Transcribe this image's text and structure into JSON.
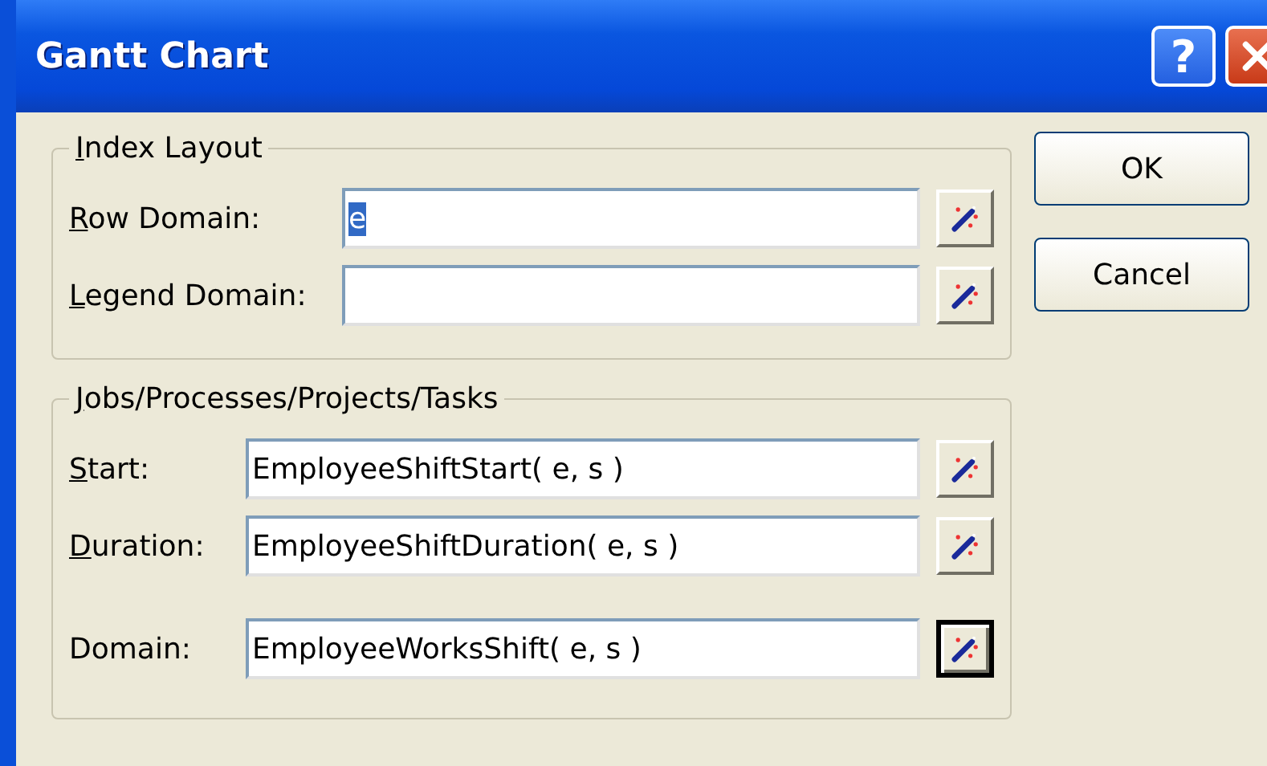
{
  "window": {
    "title": "Gantt Chart",
    "title_buttons": [
      {
        "kind": "help",
        "label": "?"
      },
      {
        "kind": "close"
      }
    ]
  },
  "groups": [
    {
      "title": "Index Layout",
      "underlined_key": true,
      "fields": [
        {
          "label": "Row Domain:",
          "underlined_key": true,
          "value": "e",
          "value_selected": true,
          "button_focused": false
        },
        {
          "label": "Legend Domain:",
          "underlined_key": true,
          "button_focused": false
        }
      ]
    },
    {
      "title": "Jobs/Processes/Projects/Tasks",
      "underlined_key": true,
      "fields": [
        {
          "label": "Start:",
          "underlined_key": true,
          "value": "EmployeeShiftStart( e, s )",
          "value_selected": false,
          "button_focused": false
        },
        {
          "label": "Duration:",
          "underlined_key": true,
          "value": "EmployeeShiftDuration( e, s )",
          "value_selected": false,
          "button_focused": false
        },
        {
          "label": "Domain:",
          "underlined_key": false,
          "value": "EmployeeWorksShift( e, s )",
          "value_selected": false,
          "button_focused": true
        }
      ]
    }
  ],
  "buttons": [
    {
      "label": "OK"
    },
    {
      "label": "Cancel"
    }
  ]
}
